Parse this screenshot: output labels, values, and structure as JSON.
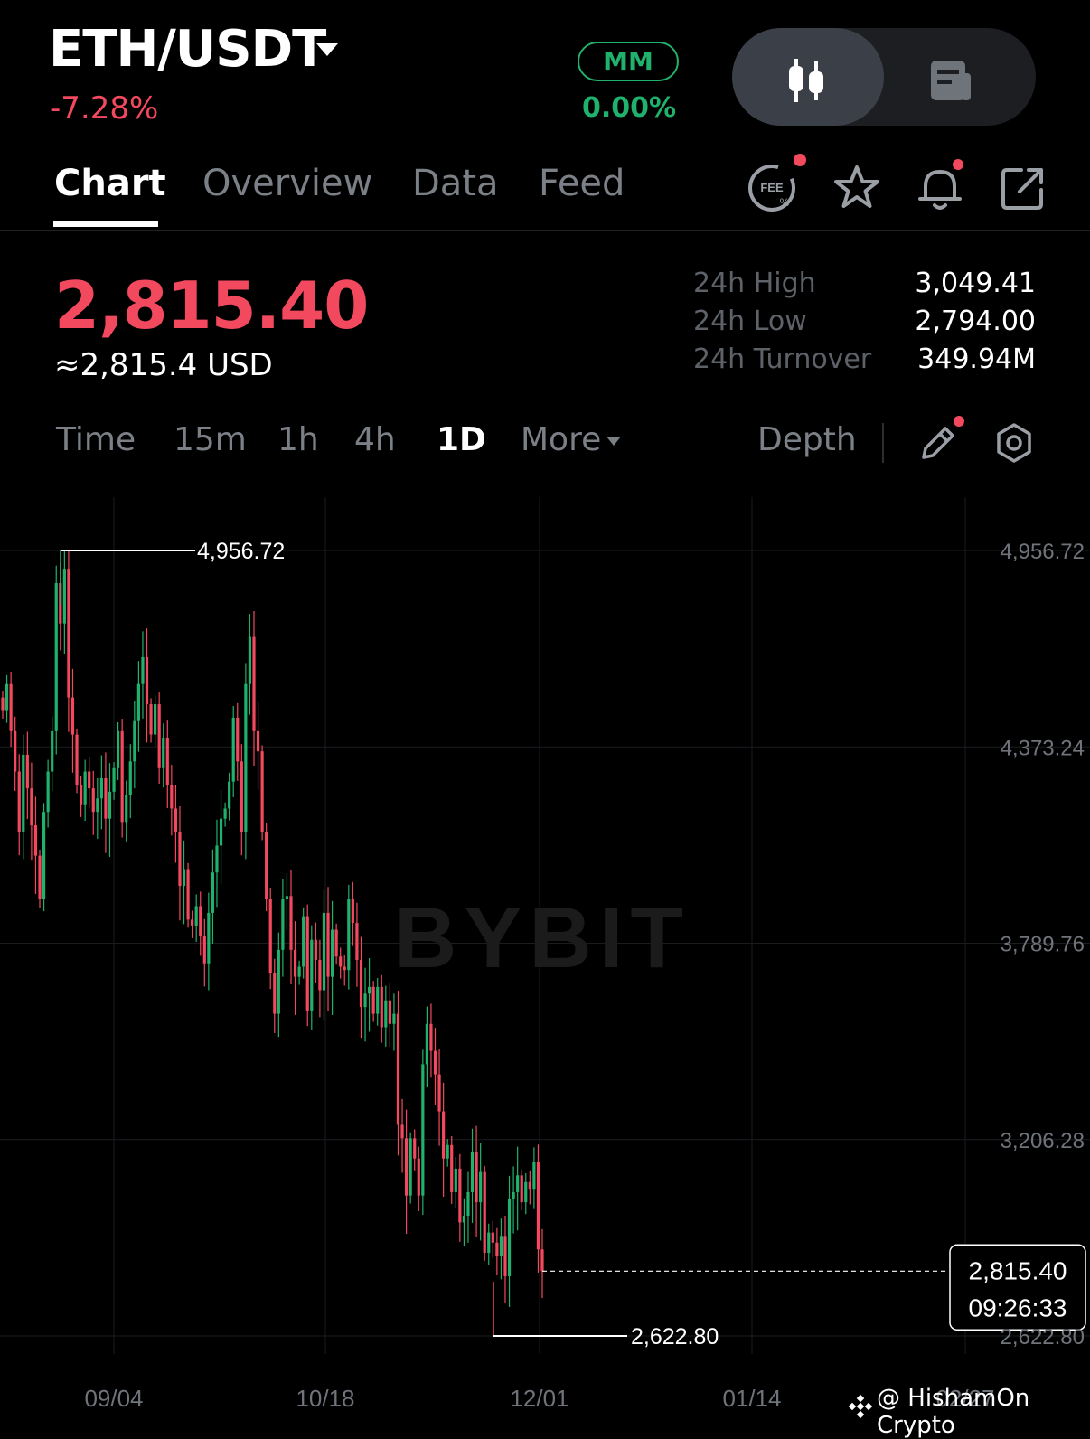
{
  "header": {
    "pair": "ETH/USDT",
    "change_pct": "-7.28%",
    "mm_label": "MM",
    "mm_value": "0.00%"
  },
  "tabs": [
    {
      "label": "Chart",
      "active": true
    },
    {
      "label": "Overview",
      "active": false
    },
    {
      "label": "Data",
      "active": false
    },
    {
      "label": "Feed",
      "active": false
    }
  ],
  "toolbar_icons": [
    "fee-icon",
    "star-icon",
    "bell-icon",
    "share-icon"
  ],
  "price": {
    "last": "2,815.40",
    "usd": "≈2,815.4 USD"
  },
  "stats": [
    {
      "label": "24h High",
      "value": "3,049.41"
    },
    {
      "label": "24h Low",
      "value": "2,794.00"
    },
    {
      "label": "24h Turnover",
      "value": "349.94M"
    }
  ],
  "intervals": {
    "items": [
      "Time",
      "15m",
      "1h",
      "4h",
      "1D",
      "More"
    ],
    "active": "1D",
    "depth": "Depth"
  },
  "colors": {
    "up": "#20b26c",
    "down": "#f2495e",
    "background": "#000000"
  },
  "chart_data": {
    "type": "candlestick",
    "watermark": "BYBIT",
    "y_ticks": [
      "4,956.72",
      "4,373.24",
      "3,789.76",
      "3,206.28",
      "2,622.80"
    ],
    "ylim": [
      2622.8,
      4956.72
    ],
    "x_ticks": [
      "09/04",
      "10/18",
      "12/01",
      "01/14",
      "02/27"
    ],
    "high_marker": "4,956.72",
    "low_marker": "2,622.80",
    "last_price": "2,815.40",
    "countdown": "09:26:33",
    "close_series": [
      4480,
      4560,
      4420,
      4300,
      4120,
      4350,
      4250,
      4140,
      4050,
      3920,
      4180,
      4300,
      4420,
      4860,
      4740,
      4900,
      4520,
      4410,
      4260,
      4200,
      4300,
      4250,
      4180,
      4220,
      4280,
      4160,
      4240,
      4310,
      4420,
      4150,
      4230,
      4330,
      4450,
      4560,
      4640,
      4500,
      4410,
      4500,
      4310,
      4400,
      4260,
      4190,
      4120,
      3960,
      4010,
      3860,
      3840,
      3900,
      3810,
      3730,
      3880,
      4000,
      4080,
      4160,
      4190,
      4270,
      4460,
      4330,
      4120,
      4560,
      4700,
      4420,
      4360,
      4120,
      3920,
      3700,
      3580,
      3770,
      3920,
      3930,
      3770,
      3690,
      3720,
      3870,
      3590,
      3800,
      3740,
      3650,
      3880,
      3690,
      3830,
      3750,
      3720,
      3710,
      3920,
      3850,
      3740,
      3600,
      3640,
      3660,
      3580,
      3660,
      3540,
      3620,
      3550,
      3580,
      3250,
      3210,
      3040,
      3210,
      3150,
      3040,
      3430,
      3550,
      3470,
      3400,
      3290,
      3150,
      3190,
      3050,
      3120,
      2960,
      2980,
      3050,
      3170,
      3020,
      3110,
      2870,
      2930,
      2900,
      2860,
      2920,
      2800,
      3030,
      3050,
      3100,
      3020,
      3080,
      3060,
      3140,
      2880,
      2815.4
    ]
  },
  "credit": "@ HishamOn Crypto"
}
